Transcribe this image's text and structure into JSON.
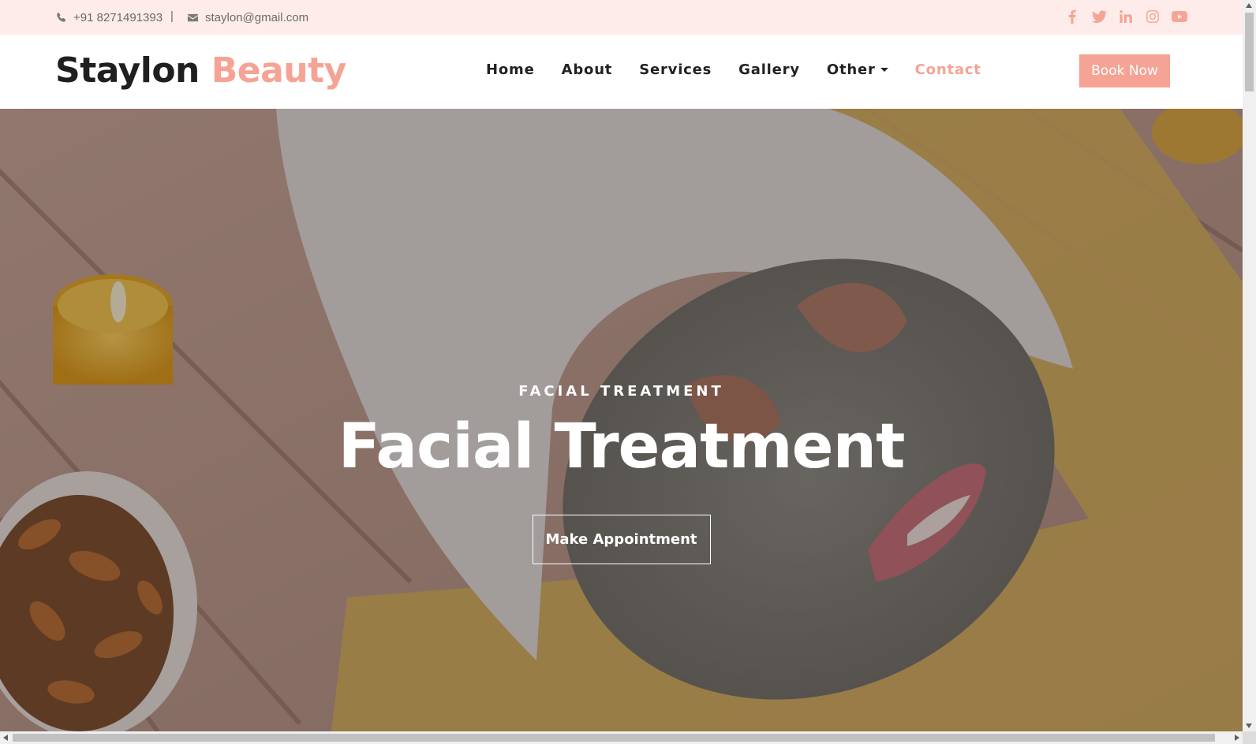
{
  "topbar": {
    "phone": "+91 8271491393",
    "separator": "|",
    "email": "staylon@gmail.com",
    "socials": [
      "facebook-icon",
      "twitter-icon",
      "linkedin-icon",
      "instagram-icon",
      "youtube-icon"
    ]
  },
  "header": {
    "logo_part1": "Staylon",
    "logo_part2": "Beauty",
    "nav": [
      {
        "label": "Home"
      },
      {
        "label": "About"
      },
      {
        "label": "Services"
      },
      {
        "label": "Gallery"
      },
      {
        "label": "Other"
      },
      {
        "label": "Contact"
      }
    ],
    "book_label": "Book Now"
  },
  "hero": {
    "subtitle": "FACIAL TREATMENT",
    "title": "Facial Treatment",
    "button_label": "Make Appointment"
  },
  "colors": {
    "accent": "#f5a394",
    "topbar_bg": "#fdecea",
    "text_dark": "#222222"
  }
}
